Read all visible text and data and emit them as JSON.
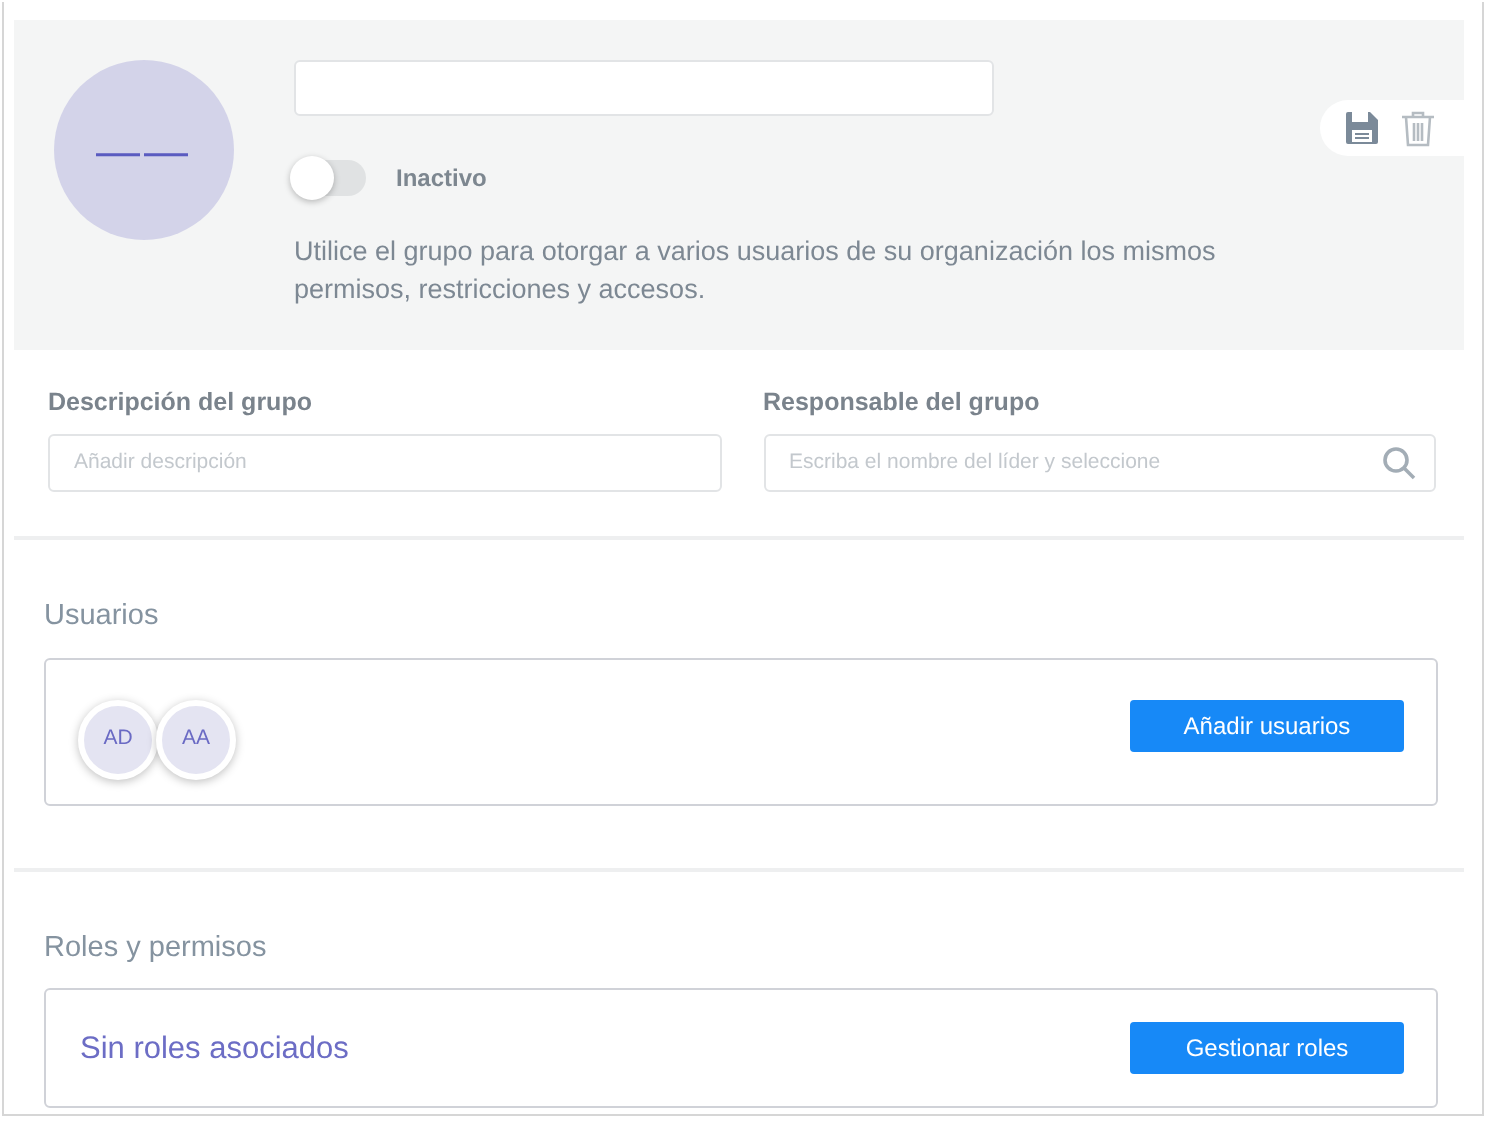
{
  "header": {
    "avatar_initials": "——",
    "status_toggle": {
      "on": false,
      "label": "Inactivo"
    },
    "description": "Utilice el grupo para otorgar a varios usuarios de su organización los mismos permisos, restricciones y accesos.",
    "actions": [
      {
        "kind": "save"
      },
      {
        "kind": "delete"
      }
    ]
  },
  "fields": [
    {
      "label": "Descripción del grupo",
      "placeholder": "Añadir descripción",
      "kind": "text"
    },
    {
      "label": "Responsable del grupo",
      "placeholder": "Escriba el nombre del líder y seleccione",
      "kind": "search"
    }
  ],
  "users": {
    "title": "Usuarios",
    "avatars": [
      "AD",
      "AA"
    ],
    "button": "Añadir usuarios"
  },
  "roles": {
    "title": "Roles y permisos",
    "empty_text": "Sin roles asociados",
    "button": "Gestionar roles"
  }
}
